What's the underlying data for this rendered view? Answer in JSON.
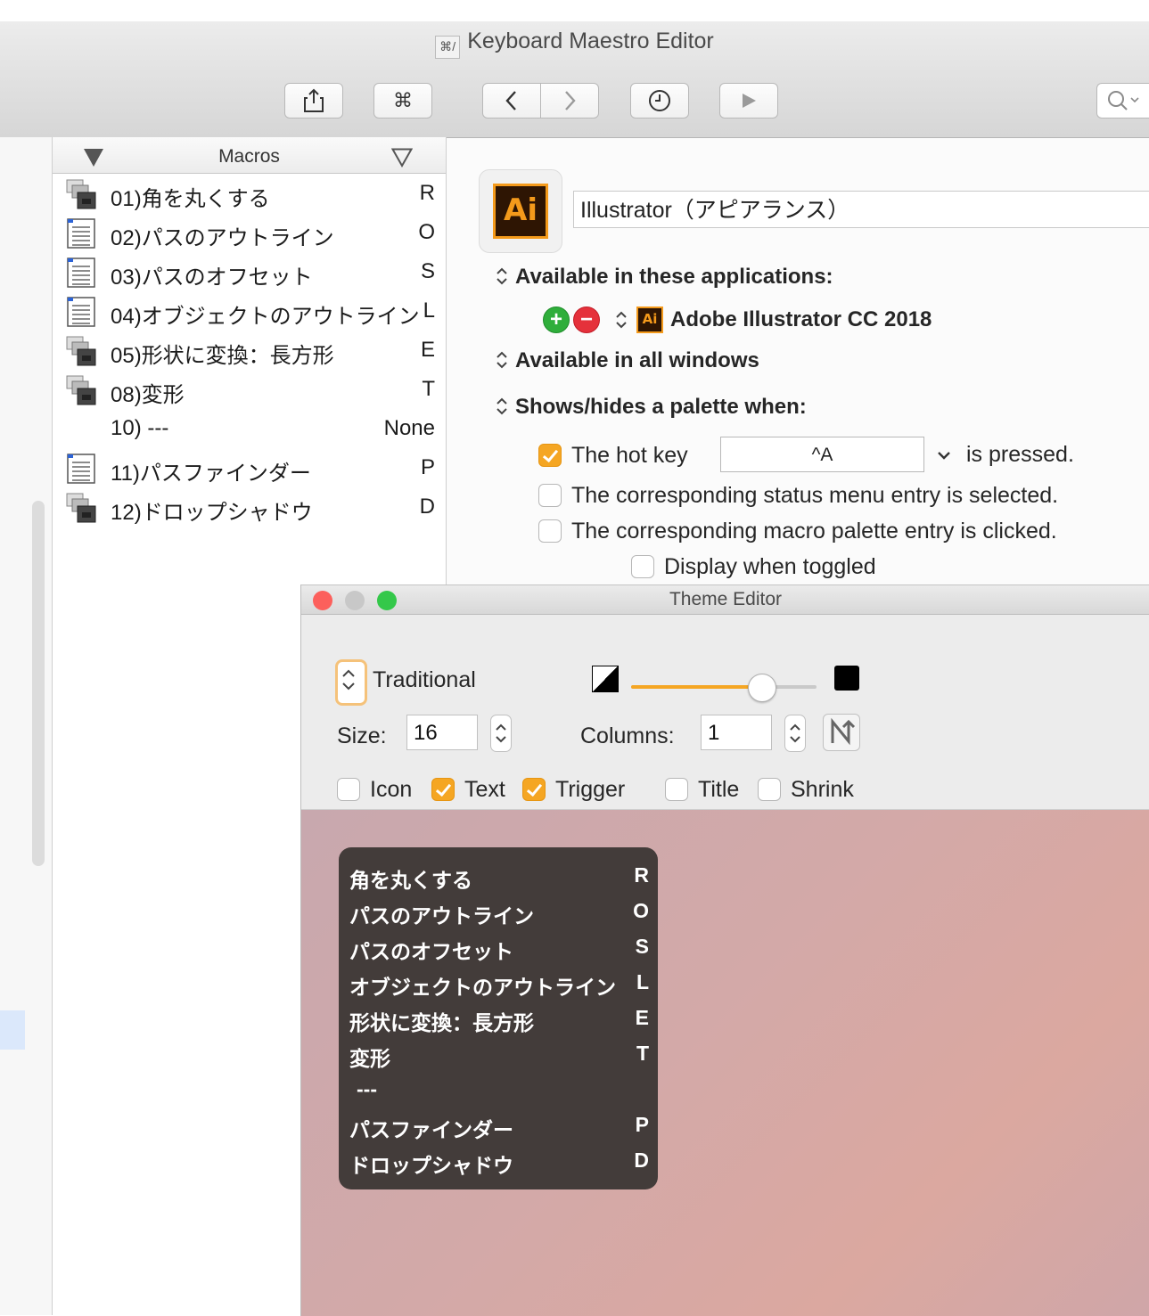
{
  "window": {
    "title": "Keyboard Maestro Editor",
    "icon": "keyboard-maestro-app-icon",
    "icon_glyph": "⌘/"
  },
  "toolbar": {
    "share_icon": "share-icon",
    "command_label": "⌘",
    "back_icon": "chevron-left-icon",
    "forward_icon": "chevron-right-icon",
    "clock_icon": "clock-icon",
    "run_icon": "play-icon",
    "search_icon": "search-icon"
  },
  "macros": {
    "header": "Macros",
    "items": [
      {
        "name": "01)角を丸くする",
        "key": "R",
        "icon": "macro-group-icon"
      },
      {
        "name": "02)パスのアウトライン",
        "key": "O",
        "icon": "list-icon"
      },
      {
        "name": "03)パスのオフセット",
        "key": "S",
        "icon": "list-icon"
      },
      {
        "name": "04)オブジェクトのアウトライン",
        "key": "L",
        "icon": "list-icon"
      },
      {
        "name": "05)形状に変換：長方形",
        "key": "E",
        "icon": "macro-group-icon"
      },
      {
        "name": "08)変形",
        "key": "T",
        "icon": "macro-group-icon"
      },
      {
        "name": "10) ---",
        "key": "None",
        "icon": ""
      },
      {
        "name": "11)パスファインダー",
        "key": "P",
        "icon": "list-icon"
      },
      {
        "name": "12)ドロップシャドウ",
        "key": "D",
        "icon": "macro-group-icon"
      }
    ]
  },
  "group": {
    "app_icon_label": "Ai",
    "name": "Illustrator（アピアランス）",
    "available_in": "Available in these applications:",
    "app_name": "Adobe Illustrator CC 2018",
    "app_icon_small": "Ai",
    "windows_label": "Available in all windows",
    "palette_label": "Shows/hides a palette when:",
    "opt_hotkey_label": "The hot key",
    "hotkey": "^A",
    "hotkey_suffix": "is pressed.",
    "opt_status_menu": "The corresponding status menu entry is selected.",
    "opt_palette_click": "The corresponding macro palette entry is clicked.",
    "opt_display_toggled": "Display when toggled"
  },
  "theme_editor": {
    "title": "Theme Editor",
    "theme_name": "Traditional",
    "size_label": "Size:",
    "size_value": "16",
    "columns_label": "Columns:",
    "columns_value": "1",
    "slider_level": 0.7,
    "checks": [
      {
        "label": "Icon",
        "checked": false
      },
      {
        "label": "Text",
        "checked": true
      },
      {
        "label": "Trigger",
        "checked": true
      },
      {
        "label": "Title",
        "checked": false
      },
      {
        "label": "Shrink",
        "checked": false
      }
    ],
    "colors": {
      "accent": "#f5a623",
      "palette_bg": "#433c3a",
      "close": "#fc605c",
      "minimize": "#c8c8c8",
      "zoom": "#34c84a"
    }
  },
  "palette": {
    "items": [
      {
        "name": "角を丸くする",
        "key": "R"
      },
      {
        "name": "パスのアウトライン",
        "key": "O"
      },
      {
        "name": "パスのオフセット",
        "key": "S"
      },
      {
        "name": "オブジェクトのアウトライン",
        "key": "L"
      },
      {
        "name": "形状に変換：長方形",
        "key": "E"
      },
      {
        "name": "変形",
        "key": "T"
      },
      {
        "name": "---",
        "key": ""
      },
      {
        "name": "パスファインダー",
        "key": "P"
      },
      {
        "name": "ドロップシャドウ",
        "key": "D"
      }
    ]
  }
}
